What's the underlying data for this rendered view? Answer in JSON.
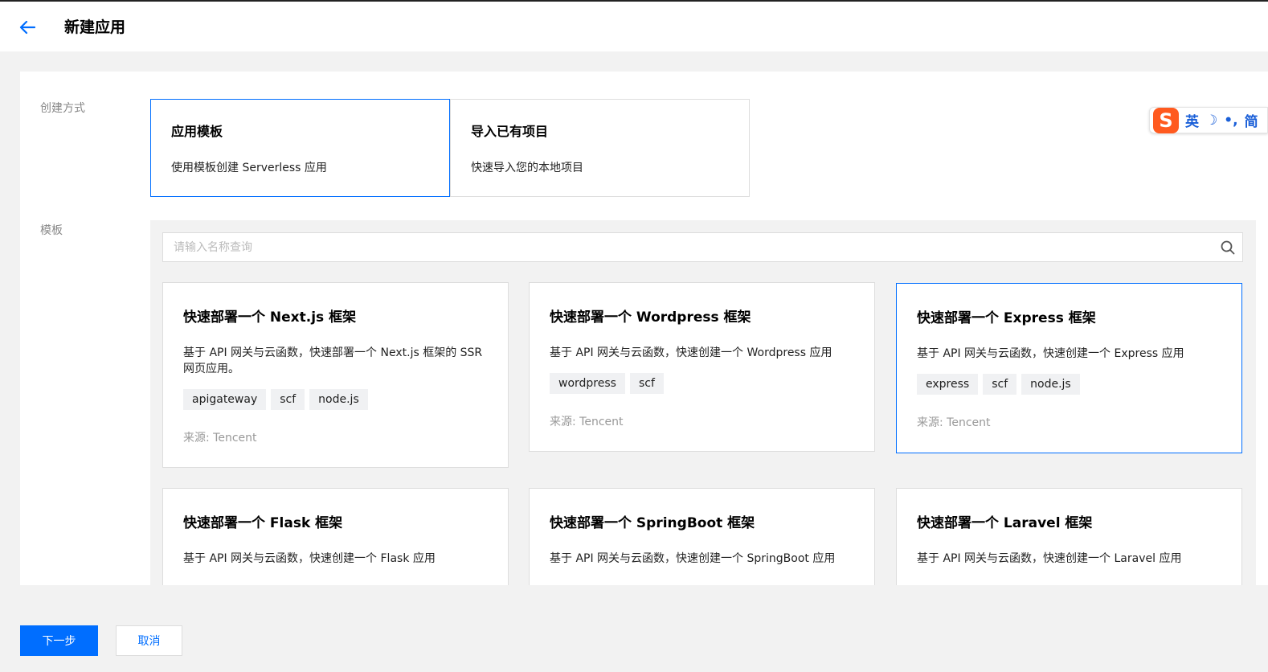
{
  "header": {
    "title": "新建应用"
  },
  "form": {
    "create_method_label": "创建方式",
    "template_label": "模板",
    "methods": [
      {
        "title": "应用模板",
        "desc": "使用模板创建 Serverless 应用",
        "selected": true
      },
      {
        "title": "导入已有项目",
        "desc": "快速导入您的本地项目",
        "selected": false
      }
    ]
  },
  "search": {
    "placeholder": "请输入名称查询"
  },
  "templates": [
    {
      "title": "快速部署一个 Next.js 框架",
      "desc": "基于 API 网关与云函数，快速部署一个 Next.js 框架的 SSR 网页应用。",
      "tags": [
        "apigateway",
        "scf",
        "node.js"
      ],
      "source": "来源: Tencent"
    },
    {
      "title": "快速部署一个 Wordpress 框架",
      "desc": "基于 API 网关与云函数，快速创建一个 Wordpress 应用",
      "tags": [
        "wordpress",
        "scf"
      ],
      "source": "来源: Tencent"
    },
    {
      "title": "快速部署一个 Express 框架",
      "desc": "基于 API 网关与云函数，快速创建一个 Express 应用",
      "tags": [
        "express",
        "scf",
        "node.js"
      ],
      "source": "来源: Tencent"
    },
    {
      "title": "快速部署一个 Flask 框架",
      "desc": "基于 API 网关与云函数，快速创建一个 Flask 应用"
    },
    {
      "title": "快速部署一个 SpringBoot 框架",
      "desc": "基于 API 网关与云函数，快速创建一个 SpringBoot 应用"
    },
    {
      "title": "快速部署一个 Laravel 框架",
      "desc": "基于 API 网关与云函数，快速创建一个 Laravel 应用"
    }
  ],
  "footer": {
    "next_label": "下一步",
    "cancel_label": "取消"
  },
  "ime": {
    "logo": "S",
    "mode": "英",
    "moon": "☽",
    "punct": "•,",
    "simp": "简"
  },
  "colors": {
    "primary": "#006eff",
    "ime_logo": "#ff5a1f"
  }
}
